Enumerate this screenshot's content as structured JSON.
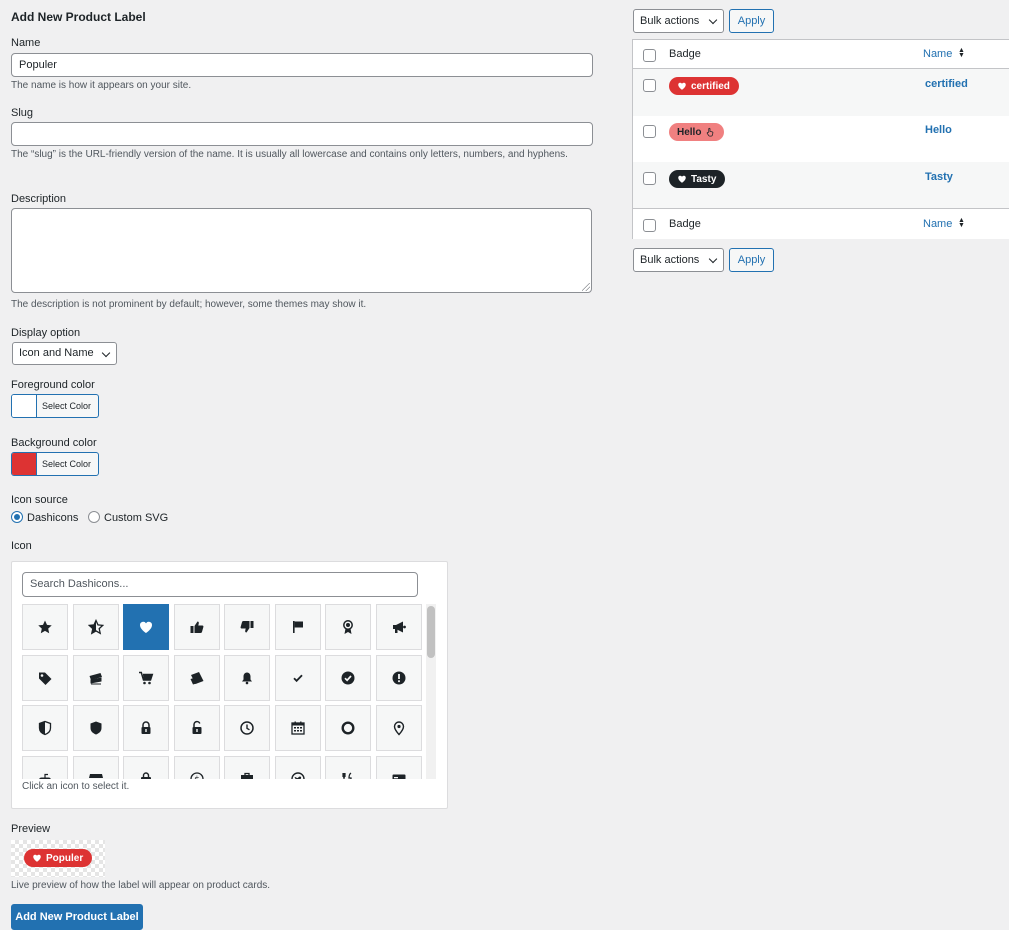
{
  "colors": {
    "accent": "#2271b1",
    "page_bg": "#f0f0f1",
    "foreground_color": "#ffffff",
    "background_color": "#dd3333"
  },
  "form": {
    "title": "Add New Product Label",
    "name": {
      "label": "Name",
      "value": "Populer",
      "help": "The name is how it appears on your site."
    },
    "slug": {
      "label": "Slug",
      "value": "",
      "help": "The “slug” is the URL-friendly version of the name. It is usually all lowercase and contains only letters, numbers, and hyphens."
    },
    "description": {
      "label": "Description",
      "value": "",
      "help": "The description is not prominent by default; however, some themes may show it."
    },
    "display_option": {
      "label": "Display option",
      "selected": "Icon and Name"
    },
    "foreground_color": {
      "label": "Foreground color",
      "button": "Select Color",
      "value": "#ffffff"
    },
    "background_color": {
      "label": "Background color",
      "button": "Select Color",
      "value": "#dd3333"
    },
    "icon_source": {
      "label": "Icon source",
      "options": [
        "Dashicons",
        "Custom SVG"
      ],
      "selected": "Dashicons"
    },
    "icon": {
      "label": "Icon",
      "search_placeholder": "Search Dashicons...",
      "help": "Click an icon to select it.",
      "selected": "heart-icon",
      "grid": [
        [
          "star-filled-icon",
          "star-half-icon",
          "heart-icon",
          "thumbs-up-icon",
          "thumbs-down-icon",
          "flag-icon",
          "awards-icon",
          "megaphone-icon"
        ],
        [
          "tag-icon",
          "tickets-icon",
          "cart-icon",
          "tickets-alt-icon",
          "bell-icon",
          "yes-icon",
          "yes-alt-icon",
          "warning-icon"
        ],
        [
          "shield-icon",
          "shield-alt-icon",
          "lock-icon",
          "unlock-icon",
          "clock-icon",
          "calendar-icon",
          "marker-icon",
          "location-icon"
        ],
        [
          "games-icon",
          "store-icon",
          "bag-icon",
          "money-icon",
          "portfolio-icon",
          "globe-icon",
          "food-icon",
          "id-card-icon"
        ]
      ]
    },
    "preview": {
      "label": "Preview",
      "badge_text": "Populer",
      "help": "Live preview of how the label will appear on product cards."
    },
    "submit_label": "Add New Product Label"
  },
  "list": {
    "bulk_actions": "Bulk actions",
    "apply": "Apply",
    "columns": {
      "badge": "Badge",
      "name": "Name"
    },
    "rows": [
      {
        "badge_text": "certified",
        "badge_bg": "#dd3333",
        "badge_fg": "#ffffff",
        "badge_icon": "heart-icon",
        "icon_first": true,
        "name": "certified"
      },
      {
        "badge_text": "Hello",
        "badge_bg": "#f08080",
        "badge_fg": "#1d2327",
        "badge_icon": "pointer-icon",
        "icon_first": false,
        "name": "Hello"
      },
      {
        "badge_text": "Tasty",
        "badge_bg": "#1d2327",
        "badge_fg": "#ffffff",
        "badge_icon": "heart-icon",
        "icon_first": true,
        "name": "Tasty"
      }
    ]
  }
}
